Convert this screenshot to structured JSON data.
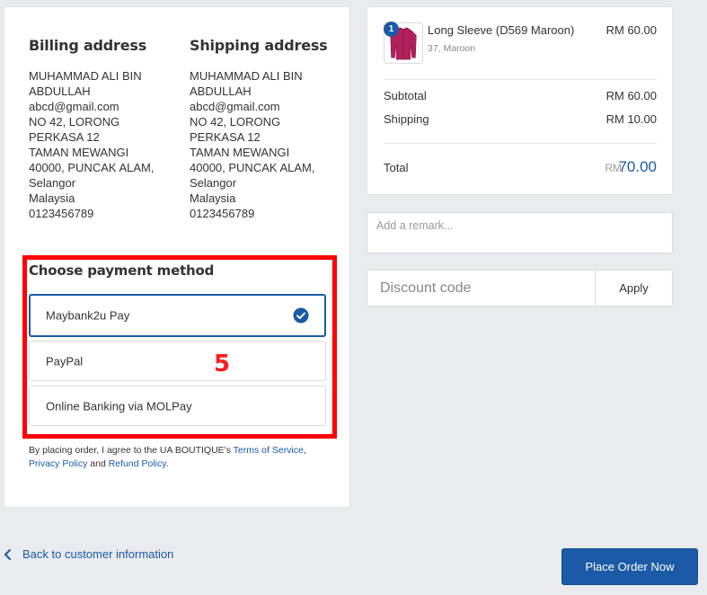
{
  "billing": {
    "heading": "Billing address",
    "lines": [
      "MUHAMMAD ALI BIN",
      "ABDULLAH",
      "abcd@gmail.com",
      "NO 42, LORONG",
      "PERKASA 12",
      "TAMAN MEWANGI",
      "40000, PUNCAK ALAM,",
      "Selangor",
      "Malaysia",
      "0123456789"
    ]
  },
  "shipping": {
    "heading": "Shipping address",
    "lines": [
      "MUHAMMAD ALI BIN",
      "ABDULLAH",
      "abcd@gmail.com",
      "NO 42, LORONG",
      "PERKASA 12",
      "TAMAN MEWANGI",
      "40000, PUNCAK ALAM,",
      "Selangor",
      "Malaysia",
      "0123456789"
    ]
  },
  "payment": {
    "title": "Choose payment method",
    "options": [
      {
        "label": "Maybank2u Pay",
        "selected": true
      },
      {
        "label": "PayPal",
        "selected": false
      },
      {
        "label": "Online Banking via MOLPay",
        "selected": false
      }
    ],
    "annotation_number": "5"
  },
  "terms": {
    "prefix": "By placing order, I agree to the UA BOUTIQUE's ",
    "terms_link": "Terms of Service",
    "comma": ",",
    "privacy_link": "Privacy Policy",
    "and": " and ",
    "refund_link": "Refund Policy",
    "end": "."
  },
  "order": {
    "product": {
      "quantity": "1",
      "name": "Long Sleeve (D569 Maroon)",
      "variant": "37, Maroon",
      "price": "RM 60.00",
      "thumb_color": "#b0205a",
      "thumb_icon": "shirt-icon"
    },
    "subtotal_label": "Subtotal",
    "subtotal_value": "RM 60.00",
    "shipping_label": "Shipping",
    "shipping_value": "RM 10.00",
    "total_label": "Total",
    "total_currency": "RM",
    "total_value": "70.00"
  },
  "remark": {
    "placeholder": "Add a remark..."
  },
  "discount": {
    "placeholder": "Discount code",
    "apply_label": "Apply"
  },
  "back_link": {
    "label": "Back to customer information",
    "icon": "chevron-left-icon"
  },
  "place_order": {
    "label": "Place Order Now"
  },
  "colors": {
    "accent": "#1a5aa6",
    "annotation": "#ff0000",
    "background": "#e9ebef"
  }
}
